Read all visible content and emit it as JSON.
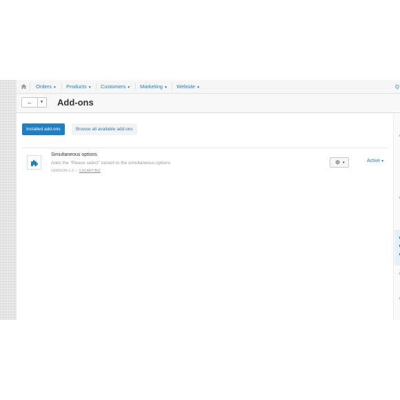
{
  "nav": {
    "items": [
      {
        "label": "Orders"
      },
      {
        "label": "Products"
      },
      {
        "label": "Customers"
      },
      {
        "label": "Marketing"
      },
      {
        "label": "Website"
      }
    ],
    "right_label": "Q"
  },
  "header": {
    "back_label": "←",
    "title": "Add-ons"
  },
  "tabs": {
    "installed": "Installed add-ons",
    "browse": "Browse all available add-ons"
  },
  "addon": {
    "name": "Simultaneous options",
    "description": "Adds the \"Please select\" variant to the simultaneous options",
    "version": "VERSION 1.0",
    "developer": "CSCART.BIZ",
    "status": "Active"
  },
  "colors": {
    "accent": "#1f7fc4",
    "link": "#1e7dbf"
  }
}
